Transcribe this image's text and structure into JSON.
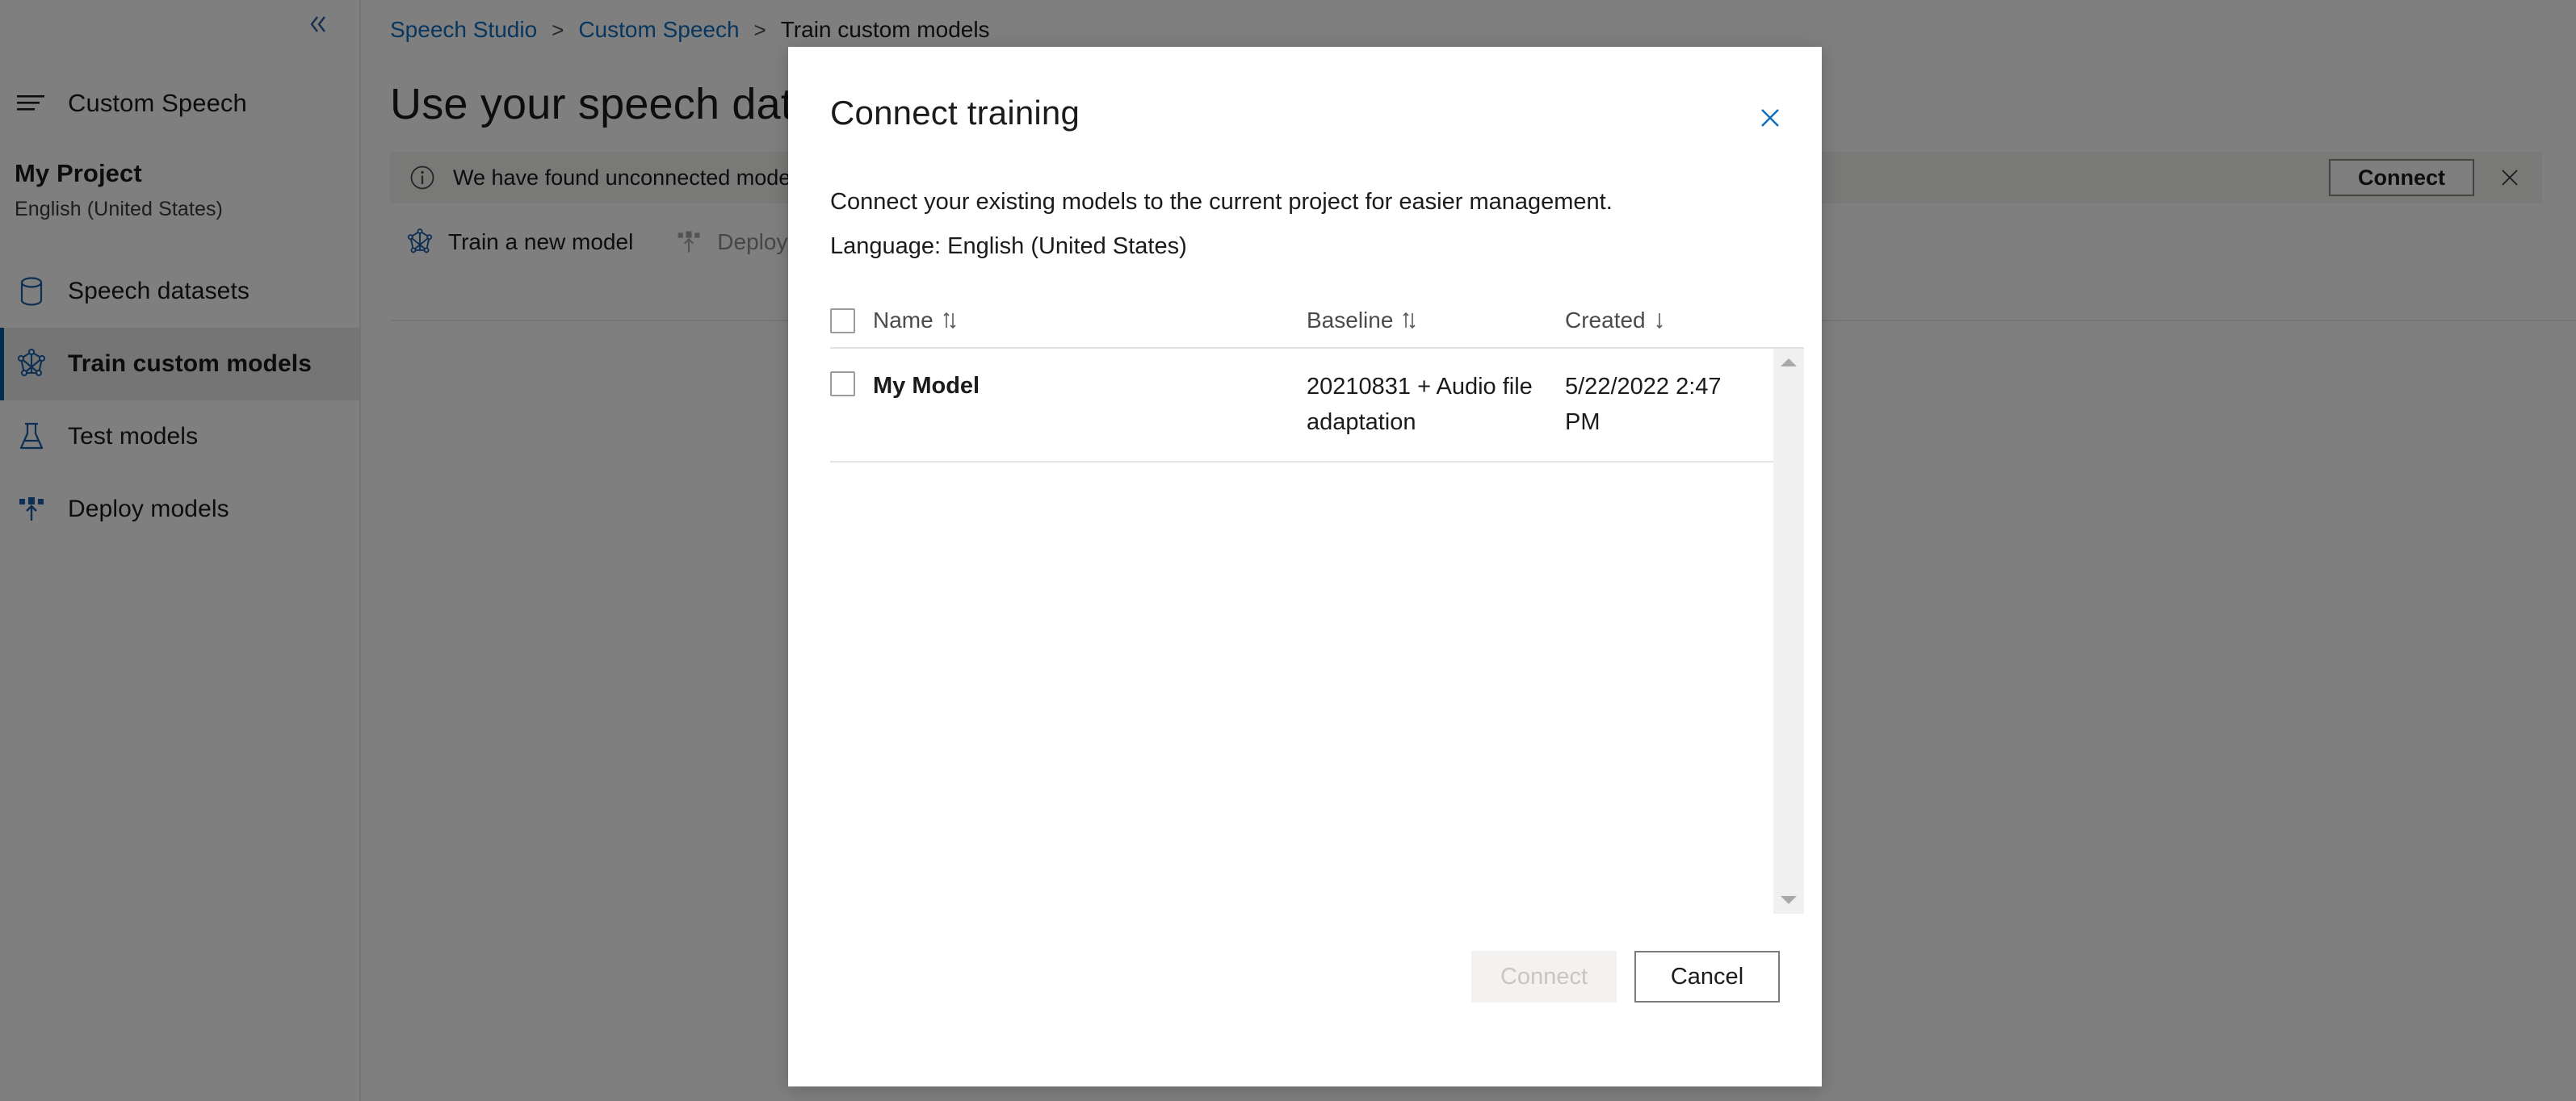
{
  "sidebar": {
    "collapse_icon": "chevron-double-left-icon",
    "hamburger_icon": "menu-icon",
    "top_label": "Custom Speech",
    "project_name": "My Project",
    "project_language": "English (United States)",
    "items": [
      {
        "label": "Speech datasets",
        "icon": "database-icon",
        "selected": false
      },
      {
        "label": "Train custom models",
        "icon": "model-graph-icon",
        "selected": true
      },
      {
        "label": "Test models",
        "icon": "flask-icon",
        "selected": false
      },
      {
        "label": "Deploy models",
        "icon": "deploy-upload-icon",
        "selected": false
      }
    ]
  },
  "breadcrumb": {
    "items": [
      "Speech Studio",
      "Custom Speech",
      "Train custom models"
    ],
    "separator": ">"
  },
  "main": {
    "page_title": "Use your speech data",
    "banner": {
      "icon": "info-circle-icon",
      "text": "We have found unconnected models and endpoints in your subscription, do you want to connect these entities to this project so you can ...",
      "connect_label": "Connect",
      "close_icon": "close-icon"
    },
    "toolbar": [
      {
        "label": "Train a new model",
        "icon": "model-graph-icon",
        "disabled": false
      },
      {
        "label": "Deploy",
        "icon": "deploy-upload-icon",
        "disabled": true
      }
    ]
  },
  "dialog": {
    "title": "Connect training",
    "close_icon": "close-icon",
    "description": "Connect your existing models to the current project for easier management.",
    "language_line": "Language: English (United States)",
    "table": {
      "columns": [
        {
          "label": "Name",
          "sort_icon": "sort-both-icon"
        },
        {
          "label": "Baseline",
          "sort_icon": "sort-both-icon"
        },
        {
          "label": "Created",
          "sort_icon": "sort-desc-icon"
        }
      ],
      "rows": [
        {
          "name": "My Model",
          "baseline": "20210831 + Audio file adaptation",
          "created": "5/22/2022 2:47 PM",
          "checked": false
        }
      ]
    },
    "scrollbar": {
      "up_icon": "scroll-up-arrow-icon",
      "down_icon": "scroll-down-arrow-icon"
    },
    "footer": {
      "connect_label": "Connect",
      "cancel_label": "Cancel"
    }
  },
  "colors": {
    "accent_blue": "#0f6cbd",
    "icon_blue": "#1b5fa8",
    "selected_bg": "#eaeaea",
    "banner_bg": "#f3f2f1",
    "overlay": "rgba(0,0,0,0.5)"
  }
}
